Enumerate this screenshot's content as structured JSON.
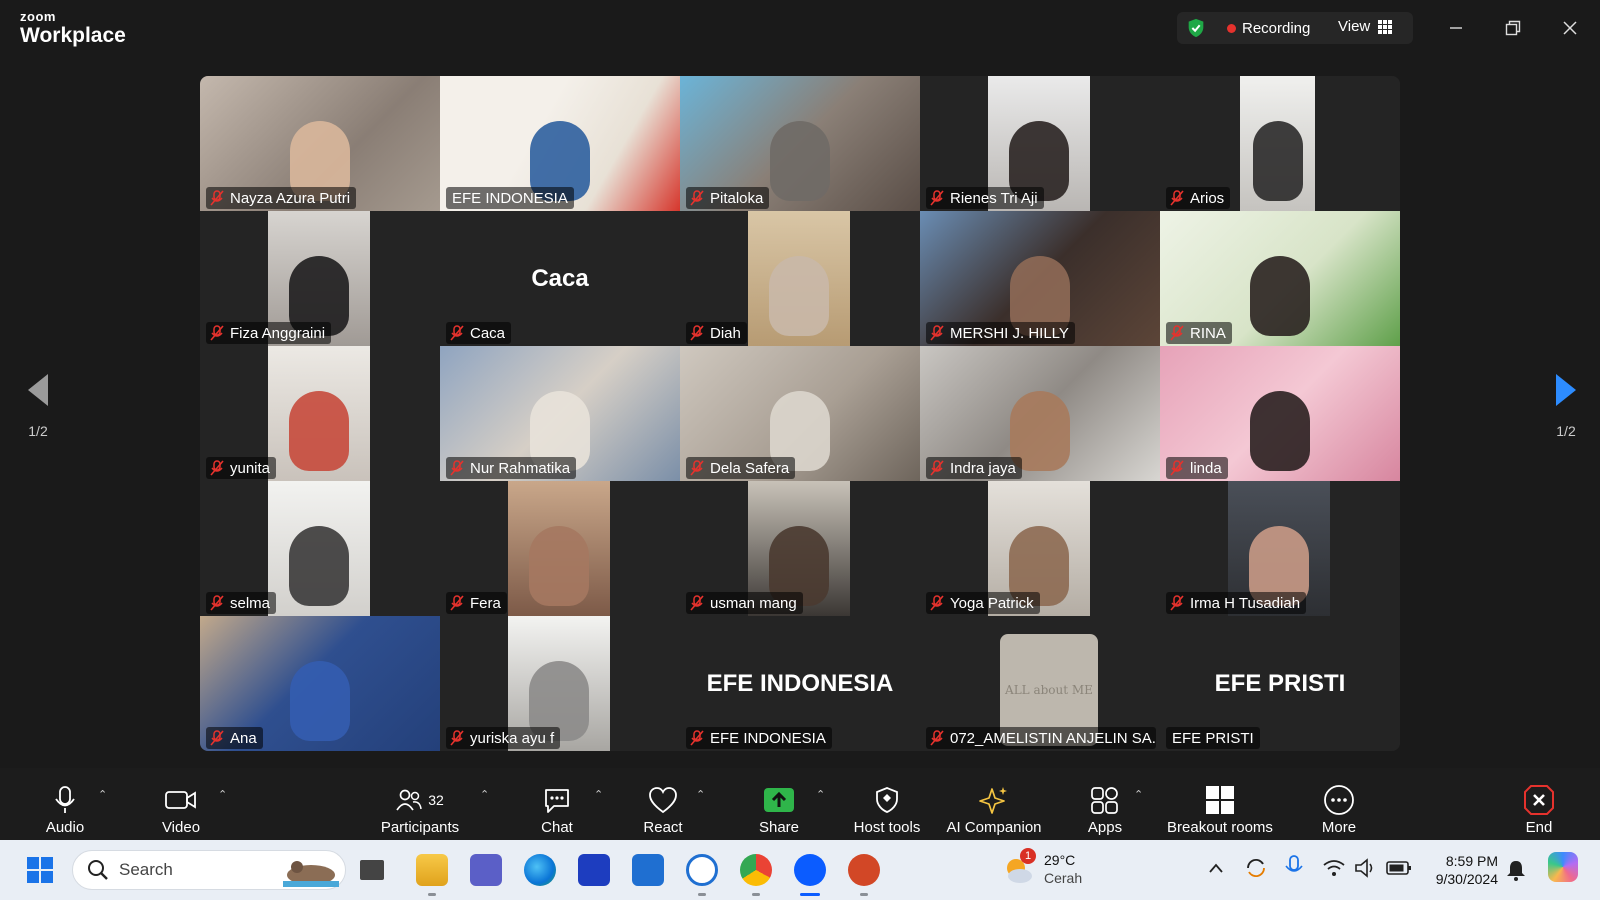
{
  "app": {
    "brand_small": "zoom",
    "brand_large": "Workplace"
  },
  "titlebar": {
    "recording_label": "Recording",
    "view_label": "View"
  },
  "colors": {
    "active_speaker": "#3bcf5c",
    "recording_dot": "#e5322d",
    "mic_muted": "#e5322d",
    "share_green": "#2fb54a",
    "shield_green": "#1fa846",
    "page_arrow": "#2d8cff"
  },
  "tiles": [
    {
      "name": "Nayza Azura Putri",
      "muted": true
    },
    {
      "name": "EFE INDONESIA",
      "muted": false,
      "active": true
    },
    {
      "name": "Pitaloka",
      "muted": true
    },
    {
      "name": "Rienes Tri Aji",
      "muted": true
    },
    {
      "name": "Arios",
      "muted": true
    },
    {
      "name": "Fiza Anggraini",
      "muted": true
    },
    {
      "name": "Caca",
      "muted": true,
      "big_name": "Caca"
    },
    {
      "name": "Diah",
      "muted": true
    },
    {
      "name": "MERSHI J. HILLY",
      "muted": true
    },
    {
      "name": "RINA",
      "muted": true
    },
    {
      "name": "yunita",
      "muted": true
    },
    {
      "name": "Nur Rahmatika",
      "muted": true
    },
    {
      "name": "Dela Safera",
      "muted": true
    },
    {
      "name": "Indra jaya",
      "muted": true
    },
    {
      "name": "linda",
      "muted": true
    },
    {
      "name": "selma",
      "muted": true
    },
    {
      "name": "Fera",
      "muted": true
    },
    {
      "name": "usman mang",
      "muted": true
    },
    {
      "name": "Yoga Patrick",
      "muted": true
    },
    {
      "name": "Irma H Tusadiah",
      "muted": true
    },
    {
      "name": "Ana",
      "muted": true
    },
    {
      "name": "yuriska ayu f",
      "muted": true
    },
    {
      "name": "EFE INDONESIA",
      "muted": true,
      "big_name": "EFE INDONESIA"
    },
    {
      "name": "072_AMELISTIN ANJELIN SA...",
      "muted": true,
      "book_text": "ALL about ME"
    },
    {
      "name": "EFE PRISTI",
      "muted": false,
      "big_name": "EFE PRISTI"
    }
  ],
  "pagination": {
    "left": "1/2",
    "right": "1/2"
  },
  "toolbar": {
    "audio": "Audio",
    "video": "Video",
    "participants": "Participants",
    "participants_count": "32",
    "chat": "Chat",
    "react": "React",
    "share": "Share",
    "host_tools": "Host tools",
    "ai_companion": "AI Companion",
    "apps": "Apps",
    "breakout_rooms": "Breakout rooms",
    "more": "More",
    "end": "End"
  },
  "taskbar": {
    "search_placeholder": "Search",
    "weather_temp": "29°C",
    "weather_desc": "Cerah",
    "weather_badge": "1",
    "time": "8:59 PM",
    "date": "9/30/2024"
  }
}
